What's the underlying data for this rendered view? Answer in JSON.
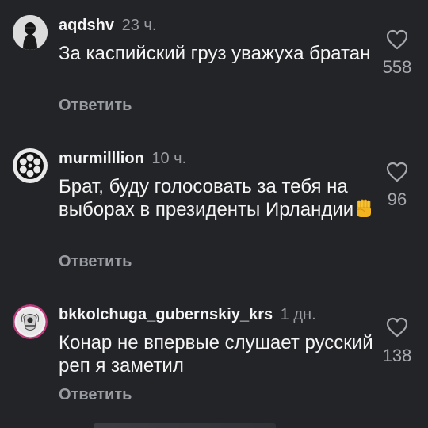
{
  "comments": [
    {
      "username": "aqdshv",
      "time": "23 ч.",
      "text": "За каспийский груз уважуха братан",
      "likes": "558",
      "reply_label": "Ответить",
      "avatar_icon": "dark-figure-avatar"
    },
    {
      "username": "murmilllion",
      "time": "10 ч.",
      "text": "Брат, буду голосовать за тебя на выборах в президенты Ирландии",
      "emoji": "raised-fist-emoji",
      "likes": "96",
      "reply_label": "Ответить",
      "avatar_icon": "revolver-cylinder-avatar"
    },
    {
      "username": "bkkolchuga_gubernskiy_krs",
      "time": "1 дн.",
      "text": "Конар не впервые слушает русский реп я заметил",
      "likes": "138",
      "reply_label": "Ответить",
      "avatar_icon": "emblem-avatar"
    }
  ],
  "colors": {
    "background": "#232428",
    "text": "#f4f4f4",
    "secondary": "#9a9ca3"
  }
}
